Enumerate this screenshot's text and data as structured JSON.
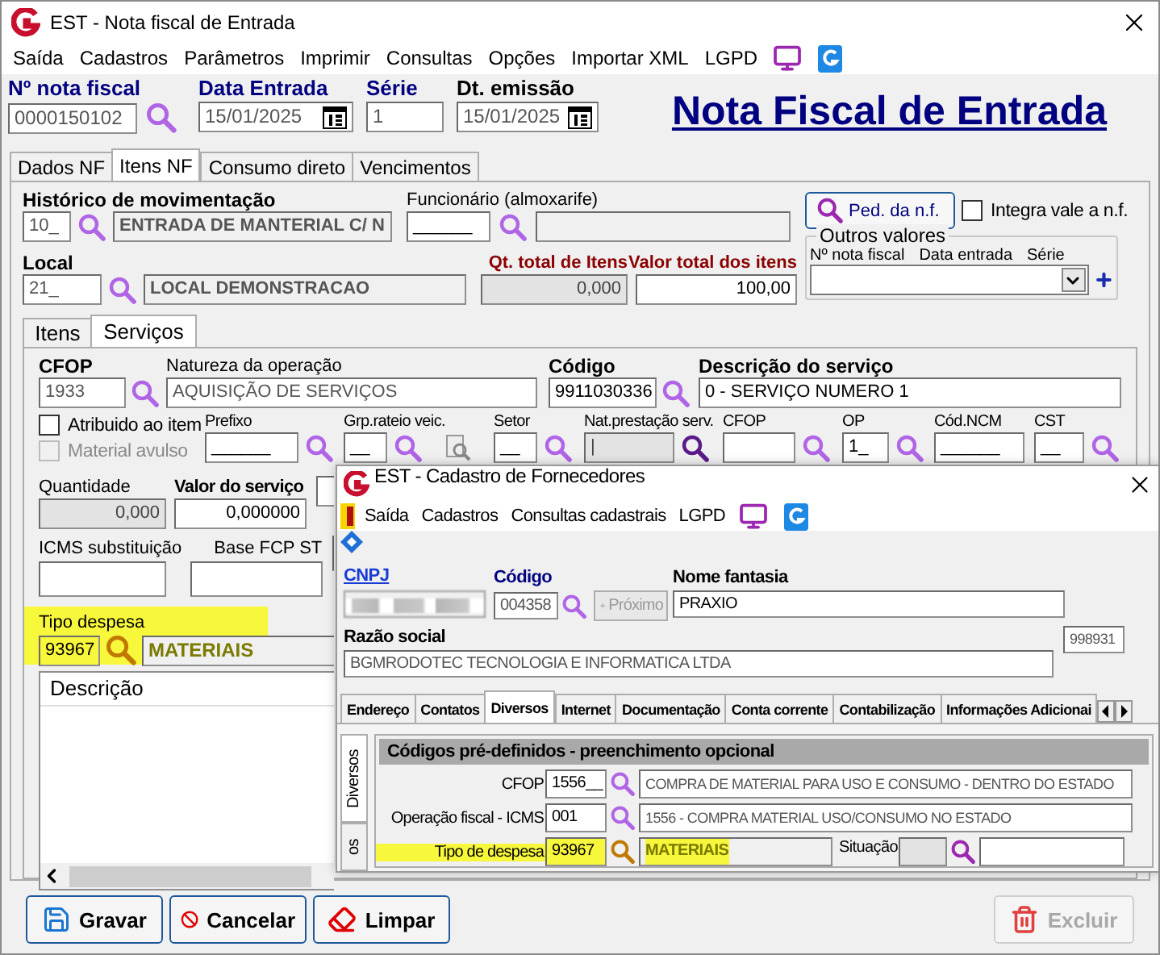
{
  "window": {
    "title": "EST - Nota fiscal de Entrada"
  },
  "menu": [
    "Saída",
    "Cadastros",
    "Parâmetros",
    "Imprimir",
    "Consultas",
    "Opções",
    "Importar XML",
    "LGPD"
  ],
  "header": {
    "heading": "Nota Fiscal de Entrada",
    "fields": [
      {
        "label": "Nº nota fiscal",
        "value": "0000150102",
        "kind": "lookup",
        "color": "#000080"
      },
      {
        "label": "Data Entrada",
        "value": "15/01/2025",
        "kind": "date",
        "color": "#000080"
      },
      {
        "label": "Série",
        "value": "1",
        "kind": "text",
        "color": "#000080"
      },
      {
        "label": "Dt. emissão",
        "value": "15/01/2025",
        "kind": "date",
        "color": "#000000"
      }
    ]
  },
  "tabs": [
    {
      "label": "Dados NF",
      "selected": false
    },
    {
      "label": "Itens NF",
      "selected": true
    },
    {
      "label": "Consumo direto",
      "selected": false
    },
    {
      "label": "Vencimentos",
      "selected": false
    }
  ],
  "movement": {
    "label": "Histórico de movimentação",
    "code": "10_",
    "description": "ENTRADA DE MANTERIAL C/ N"
  },
  "employee": {
    "label": "Funcionário (almoxarife)",
    "code": "______"
  },
  "order_button": "Ped. da n.f.",
  "integrate": {
    "label": "Integra vale a n.f.",
    "checked": false
  },
  "local": {
    "label": "Local",
    "code": "21_",
    "description": "LOCAL DEMONSTRACAO"
  },
  "totals": [
    {
      "label": "Qt. total de Itens",
      "value": "0,000",
      "disabled": true
    },
    {
      "label": "Valor total dos itens",
      "value": "100,00",
      "disabled": false
    }
  ],
  "other_values": {
    "legend": "Outros valores",
    "columns": [
      "Nº nota fiscal",
      "Data entrada",
      "Série"
    ]
  },
  "sub_tabs": [
    {
      "label": "Itens",
      "selected": false
    },
    {
      "label": "Serviços",
      "selected": true
    }
  ],
  "service": {
    "cfop": {
      "label": "CFOP",
      "code": "1933",
      "description_label": "Natureza da operação",
      "description": "AQUISIÇÃO DE SERVIÇOS"
    },
    "code": {
      "label": "Código",
      "code": "9911030336",
      "description_label": "Descrição do serviço",
      "description": "0 - SERVIÇO NUMERO 1"
    },
    "options": [
      {
        "label": "Atribuido ao item",
        "checked": false,
        "disabled": false
      },
      {
        "label": "Material avulso",
        "checked": false,
        "disabled": true
      }
    ],
    "small_fields": [
      {
        "label": "Prefixo",
        "value": "______",
        "search": true,
        "disabled": false
      },
      {
        "label": "Grp.rateio veic.",
        "value": "__",
        "search": true,
        "disabled": false,
        "tool": true
      },
      {
        "label": "Setor",
        "value": "__",
        "search": true,
        "disabled": false
      },
      {
        "label": "Nat.prestação serv.",
        "value": "|",
        "search": true,
        "disabled": true
      },
      {
        "label": "CFOP",
        "search": true,
        "disabled": false
      },
      {
        "label": "OP",
        "value": "1_",
        "search": true,
        "disabled": false
      },
      {
        "label": "Cód.NCM",
        "value": "______",
        "search": false,
        "disabled": false
      },
      {
        "label": "CST",
        "value": "__",
        "search": true,
        "disabled": false
      }
    ],
    "quantity": {
      "label": "Quantidade",
      "value": "0,000",
      "disabled": true
    },
    "service_value": {
      "label": "Valor do serviço",
      "value": "0,000000"
    },
    "icms_st": {
      "label": "ICMS substituição"
    },
    "fcp_st": {
      "label": "Base FCP ST"
    },
    "expense": {
      "label": "Tipo despesa",
      "code": "93967",
      "description": "MATERIAIS",
      "highlighted": true
    },
    "description_list": {
      "header": "Descrição"
    }
  },
  "supplier_window": {
    "title": "EST - Cadastro de Fornecedores",
    "menu": [
      "Saída",
      "Cadastros",
      "Consultas cadastrais",
      "LGPD"
    ],
    "cnpj": {
      "label": "CNPJ"
    },
    "code": {
      "label": "Código",
      "value": "004358"
    },
    "next_button": {
      "label": "Próximo",
      "disabled": true
    },
    "trade_name": {
      "label": "Nome fantasia",
      "value": "PRAXIO"
    },
    "company": {
      "label": "Razão social",
      "value": "BGMRODOTEC TECNOLOGIA E INFORMATICA LTDA",
      "code": "998931"
    },
    "tabs": [
      {
        "label": "Endereço",
        "selected": false
      },
      {
        "label": "Contatos",
        "selected": false
      },
      {
        "label": "Diversos",
        "selected": true
      },
      {
        "label": "Internet",
        "selected": false
      },
      {
        "label": "Documentação",
        "selected": false
      },
      {
        "label": "Conta corrente",
        "selected": false
      },
      {
        "label": "Contabilização",
        "selected": false
      },
      {
        "label": "Informações Adicionai",
        "selected": false
      }
    ],
    "side_tabs": [
      {
        "label": "Diversos",
        "selected": true
      },
      {
        "label": "os",
        "selected": false
      }
    ],
    "group": {
      "title": "Códigos pré-definidos - preenchimento opcional",
      "rows": [
        {
          "label": "CFOP",
          "code": "1556__",
          "description": "COMPRA DE MATERIAL PARA USO E CONSUMO - DENTRO DO ESTADO",
          "highlighted": false
        },
        {
          "label": "Operação fiscal - ICMS",
          "code": "001",
          "description": "1556 - COMPRA MATERIAL USO/CONSUMO NO ESTADO",
          "highlighted": false
        },
        {
          "label": "Tipo de despesa",
          "code": "93967",
          "description": "MATERIAIS",
          "highlighted": true
        }
      ],
      "situation": {
        "label": "Situação"
      }
    }
  },
  "buttons": [
    {
      "label": "Gravar",
      "kind": "save",
      "disabled": false
    },
    {
      "label": "Cancelar",
      "kind": "cancel",
      "disabled": false
    },
    {
      "label": "Limpar",
      "kind": "clear",
      "disabled": false
    },
    {
      "label": "Excluir",
      "kind": "delete",
      "disabled": true
    }
  ]
}
